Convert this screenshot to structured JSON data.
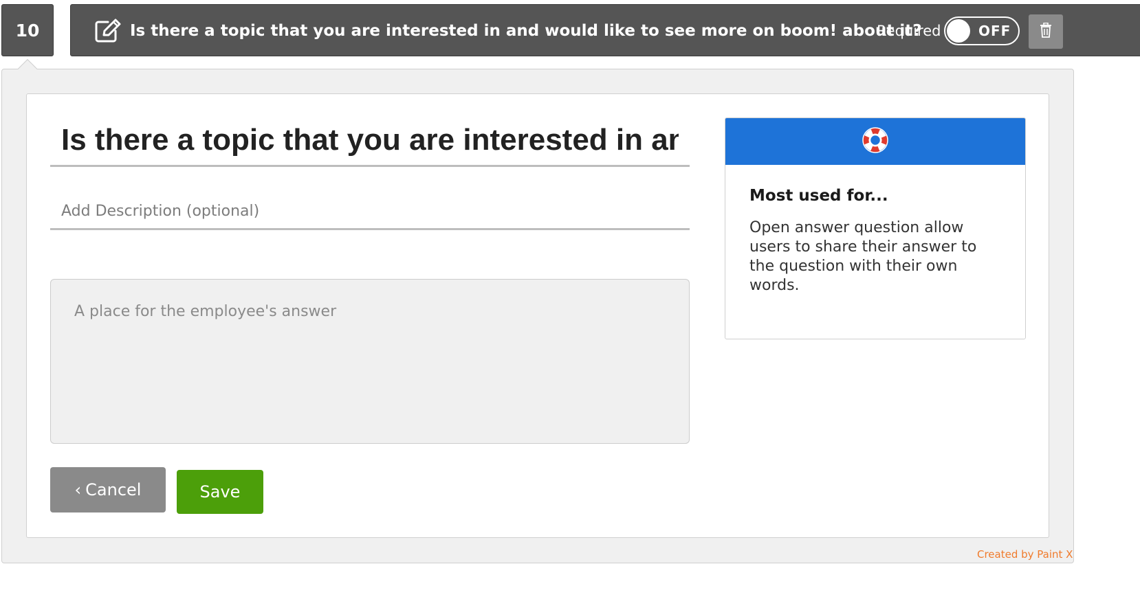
{
  "question": {
    "number": "10",
    "title": "Is there a topic that you are interested in and would like to see more on boom! about it?",
    "edit_icon": "pencil-square-icon",
    "required_label": "Required",
    "required_toggle_state": "OFF",
    "delete_icon": "trash-icon"
  },
  "editor": {
    "title_value": "Is there a topic that you are interested in and would like to see more on boom! about it?",
    "description_placeholder": "Add Description (optional)",
    "answer_placeholder": "A place for the employee's answer",
    "cancel_arrow": "‹",
    "cancel_label": "Cancel",
    "save_label": "Save"
  },
  "help": {
    "icon": "lifebuoy-icon",
    "title": "Most used for...",
    "text": "Open answer question allow users to share their answer to the question with their own words."
  },
  "watermark": "Created by Paint X",
  "colors": {
    "bar": "#555555",
    "help_header": "#1e73d8",
    "save_button": "#4c9f0a",
    "cancel_button": "#8a8a8a",
    "watermark": "#f07b2c"
  }
}
